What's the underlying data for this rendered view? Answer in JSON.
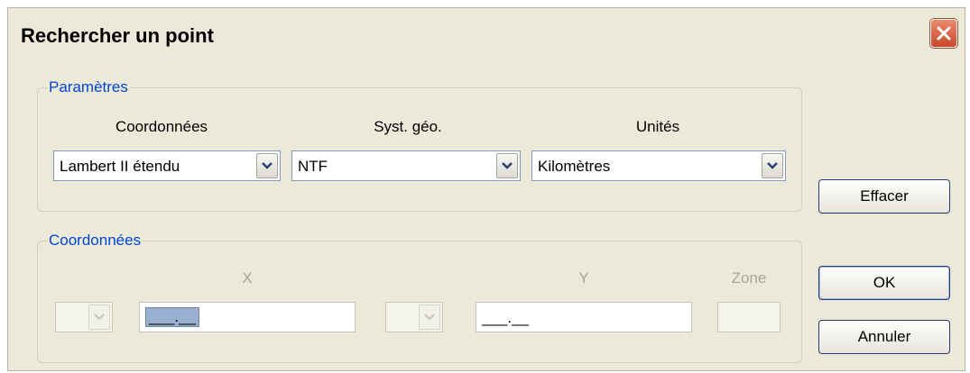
{
  "window": {
    "title": "Rechercher un point"
  },
  "parametres": {
    "legend": "Paramètres",
    "headers": {
      "coordonnees": "Coordonnées",
      "syst_geo": "Syst. géo.",
      "unites": "Unités"
    },
    "coordonnees_value": "Lambert II étendu",
    "syst_geo_value": "NTF",
    "unites_value": "Kilomètres"
  },
  "coordonnees": {
    "legend": "Coordonnées",
    "x_label": "X",
    "y_label": "Y",
    "zone_label": "Zone",
    "x_value": "___.__",
    "y_value": "___.__",
    "zone_value": ""
  },
  "buttons": {
    "effacer": "Effacer",
    "ok": "OK",
    "annuler": "Annuler"
  },
  "icons": {
    "close": "close-icon",
    "dropdown": "chevron-down-icon"
  },
  "colors": {
    "legend": "#0046d5",
    "close": "#d9593a",
    "dialog_bg": "#ece9d8"
  }
}
